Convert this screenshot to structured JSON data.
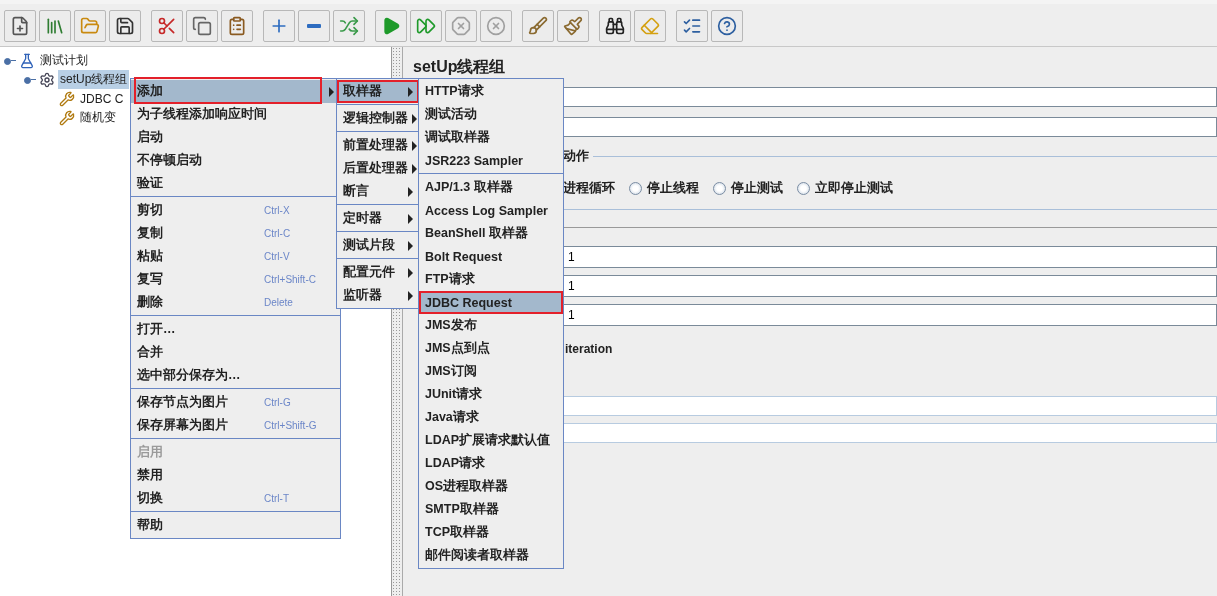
{
  "toolbar": {
    "groups": [
      [
        {
          "kind": "new",
          "disabled": false
        },
        {
          "kind": "templates",
          "disabled": false
        },
        {
          "kind": "open",
          "disabled": false
        },
        {
          "kind": "save",
          "disabled": false
        }
      ],
      [
        {
          "kind": "cut",
          "disabled": false
        },
        {
          "kind": "copy",
          "disabled": false
        },
        {
          "kind": "paste",
          "disabled": false
        }
      ],
      [
        {
          "kind": "expand",
          "disabled": false
        },
        {
          "kind": "collapse",
          "disabled": false
        },
        {
          "kind": "toggle",
          "disabled": false
        }
      ],
      [
        {
          "kind": "start",
          "disabled": false
        },
        {
          "kind": "start-no-pause",
          "disabled": false
        },
        {
          "kind": "stop",
          "disabled": true
        },
        {
          "kind": "shutdown",
          "disabled": true
        }
      ],
      [
        {
          "kind": "clear",
          "disabled": false
        },
        {
          "kind": "clear-all",
          "disabled": false
        }
      ],
      [
        {
          "kind": "search",
          "disabled": false
        },
        {
          "kind": "reset-search",
          "disabled": false
        }
      ],
      [
        {
          "kind": "function-helper",
          "disabled": false
        },
        {
          "kind": "help",
          "disabled": false
        }
      ]
    ]
  },
  "tree": {
    "nodes": [
      {
        "label": "测试计划",
        "kind": "plan",
        "expanded": true,
        "selected": false,
        "children": [
          {
            "label": "setUp线程组",
            "kind": "thread-group",
            "expanded": true,
            "selected": true,
            "children": [
              {
                "label": "JDBC C",
                "kind": "config",
                "selected": false
              },
              {
                "label": "随机变",
                "kind": "config",
                "selected": false
              }
            ]
          }
        ]
      }
    ]
  },
  "panel": {
    "title": "setUp线程组",
    "name_fields": [
      {
        "kind": "text"
      },
      {
        "kind": "text"
      }
    ],
    "action_section": {
      "heading": "动作",
      "lead_text": "进程循环",
      "options": [
        {
          "label": "停止线程",
          "selected": false
        },
        {
          "label": "停止测试",
          "selected": false
        },
        {
          "label": "立即停止测试",
          "selected": false
        }
      ]
    },
    "number_fields": [
      {
        "value": "1"
      },
      {
        "value": "1"
      },
      {
        "value": "1"
      }
    ],
    "iteration_label": "iteration",
    "extra_fields": [
      {
        "kind": "text"
      },
      {
        "kind": "text"
      }
    ]
  },
  "context_menu": {
    "groups": [
      [
        {
          "label": "添加",
          "has_submenu": true,
          "selected": true,
          "disabled": false
        },
        {
          "label": "为子线程添加响应时间",
          "has_submenu": false,
          "selected": false,
          "disabled": false
        },
        {
          "label": "启动",
          "has_submenu": false,
          "selected": false,
          "disabled": false
        },
        {
          "label": "不停顿启动",
          "has_submenu": false,
          "selected": false,
          "disabled": false
        },
        {
          "label": "验证",
          "has_submenu": false,
          "selected": false,
          "disabled": false
        }
      ],
      [
        {
          "label": "剪切",
          "shortcut": "Ctrl-X",
          "has_submenu": false,
          "selected": false,
          "disabled": false
        },
        {
          "label": "复制",
          "shortcut": "Ctrl-C",
          "has_submenu": false,
          "selected": false,
          "disabled": false
        },
        {
          "label": "粘贴",
          "shortcut": "Ctrl-V",
          "has_submenu": false,
          "selected": false,
          "disabled": false
        },
        {
          "label": "复写",
          "shortcut": "Ctrl+Shift-C",
          "has_submenu": false,
          "selected": false,
          "disabled": false
        },
        {
          "label": "删除",
          "shortcut": "Delete",
          "has_submenu": false,
          "selected": false,
          "disabled": false
        }
      ],
      [
        {
          "label": "打开…",
          "has_submenu": false,
          "selected": false,
          "disabled": false
        },
        {
          "label": "合并",
          "has_submenu": false,
          "selected": false,
          "disabled": false
        },
        {
          "label": "选中部分保存为…",
          "has_submenu": false,
          "selected": false,
          "disabled": false
        }
      ],
      [
        {
          "label": "保存节点为图片",
          "shortcut": "Ctrl-G",
          "has_submenu": false,
          "selected": false,
          "disabled": false
        },
        {
          "label": "保存屏幕为图片",
          "shortcut": "Ctrl+Shift-G",
          "has_submenu": false,
          "selected": false,
          "disabled": false
        }
      ],
      [
        {
          "label": "启用",
          "has_submenu": false,
          "selected": false,
          "disabled": true
        },
        {
          "label": "禁用",
          "has_submenu": false,
          "selected": false,
          "disabled": false
        },
        {
          "label": "切换",
          "shortcut": "Ctrl-T",
          "has_submenu": false,
          "selected": false,
          "disabled": false
        }
      ],
      [
        {
          "label": "帮助",
          "has_submenu": false,
          "selected": false,
          "disabled": false
        }
      ]
    ]
  },
  "add_menu": {
    "groups": [
      [
        {
          "label": "取样器",
          "has_submenu": true,
          "selected": true
        }
      ],
      [
        {
          "label": "逻辑控制器",
          "has_submenu": true,
          "selected": false
        }
      ],
      [
        {
          "label": "前置处理器",
          "has_submenu": true,
          "selected": false
        },
        {
          "label": "后置处理器",
          "has_submenu": true,
          "selected": false
        },
        {
          "label": "断言",
          "has_submenu": true,
          "selected": false
        }
      ],
      [
        {
          "label": "定时器",
          "has_submenu": true,
          "selected": false
        }
      ],
      [
        {
          "label": "测试片段",
          "has_submenu": true,
          "selected": false
        }
      ],
      [
        {
          "label": "配置元件",
          "has_submenu": true,
          "selected": false
        },
        {
          "label": "监听器",
          "has_submenu": true,
          "selected": false
        }
      ]
    ]
  },
  "sampler_menu": {
    "groups": [
      [
        {
          "label": "HTTP请求",
          "selected": false
        },
        {
          "label": "测试活动",
          "selected": false
        },
        {
          "label": "调试取样器",
          "selected": false
        },
        {
          "label": "JSR223 Sampler",
          "selected": false
        }
      ],
      [
        {
          "label": "AJP/1.3 取样器",
          "selected": false
        },
        {
          "label": "Access Log Sampler",
          "selected": false
        },
        {
          "label": "BeanShell 取样器",
          "selected": false
        },
        {
          "label": "Bolt Request",
          "selected": false
        },
        {
          "label": "FTP请求",
          "selected": false
        },
        {
          "label": "JDBC Request",
          "selected": true
        },
        {
          "label": "JMS发布",
          "selected": false
        },
        {
          "label": "JMS点到点",
          "selected": false
        },
        {
          "label": "JMS订阅",
          "selected": false
        },
        {
          "label": "JUnit请求",
          "selected": false
        },
        {
          "label": "Java请求",
          "selected": false
        },
        {
          "label": "LDAP扩展请求默认值",
          "selected": false
        },
        {
          "label": "LDAP请求",
          "selected": false
        },
        {
          "label": "OS进程取样器",
          "selected": false
        },
        {
          "label": "SMTP取样器",
          "selected": false
        },
        {
          "label": "TCP取样器",
          "selected": false
        },
        {
          "label": "邮件阅读者取样器",
          "selected": false
        }
      ]
    ]
  }
}
